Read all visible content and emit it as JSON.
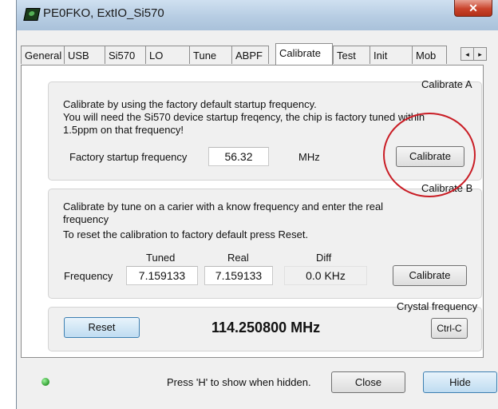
{
  "window": {
    "title": "PE0FKO, ExtIO_Si570",
    "close_glyph": "✕"
  },
  "tabs": [
    {
      "label": "General"
    },
    {
      "label": "USB"
    },
    {
      "label": "Si570"
    },
    {
      "label": "LO"
    },
    {
      "label": "Tune"
    },
    {
      "label": "ABPF"
    },
    {
      "label": "Calibrate"
    },
    {
      "label": "Test"
    },
    {
      "label": "Init"
    },
    {
      "label": "Mob"
    }
  ],
  "tab_scroll": {
    "left": "◂",
    "right": "▸"
  },
  "calibrate_a": {
    "label": "Calibrate A",
    "line1": "Calibrate by using the factory default startup frequency.",
    "line2": "You will need the Si570 device startup freqency, the chip is factory tuned within",
    "line3": "1.5ppm on that frequency!",
    "freq_label": "Factory startup frequency",
    "freq_value": "56.32",
    "unit": "MHz",
    "button": "Calibrate"
  },
  "calibrate_b": {
    "label": "Calibrate B",
    "line1": "Calibrate by tune on a carier with a know frequency and enter the real",
    "line2": "frequency",
    "line3": "To reset the calibration to factory default press Reset.",
    "col_tuned": "Tuned",
    "col_real": "Real",
    "col_diff": "Diff",
    "row_label": "Frequency",
    "tuned_value": "7.159133",
    "real_value": "7.159133",
    "diff_value": "0.0 KHz",
    "button": "Calibrate"
  },
  "crystal": {
    "label": "Crystal frequency",
    "reset_button": "Reset",
    "value": "114.250800 MHz",
    "copy_button": "Ctrl-C"
  },
  "footer": {
    "hint": "Press 'H' to show when hidden.",
    "close_button": "Close",
    "hide_button": "Hide"
  }
}
